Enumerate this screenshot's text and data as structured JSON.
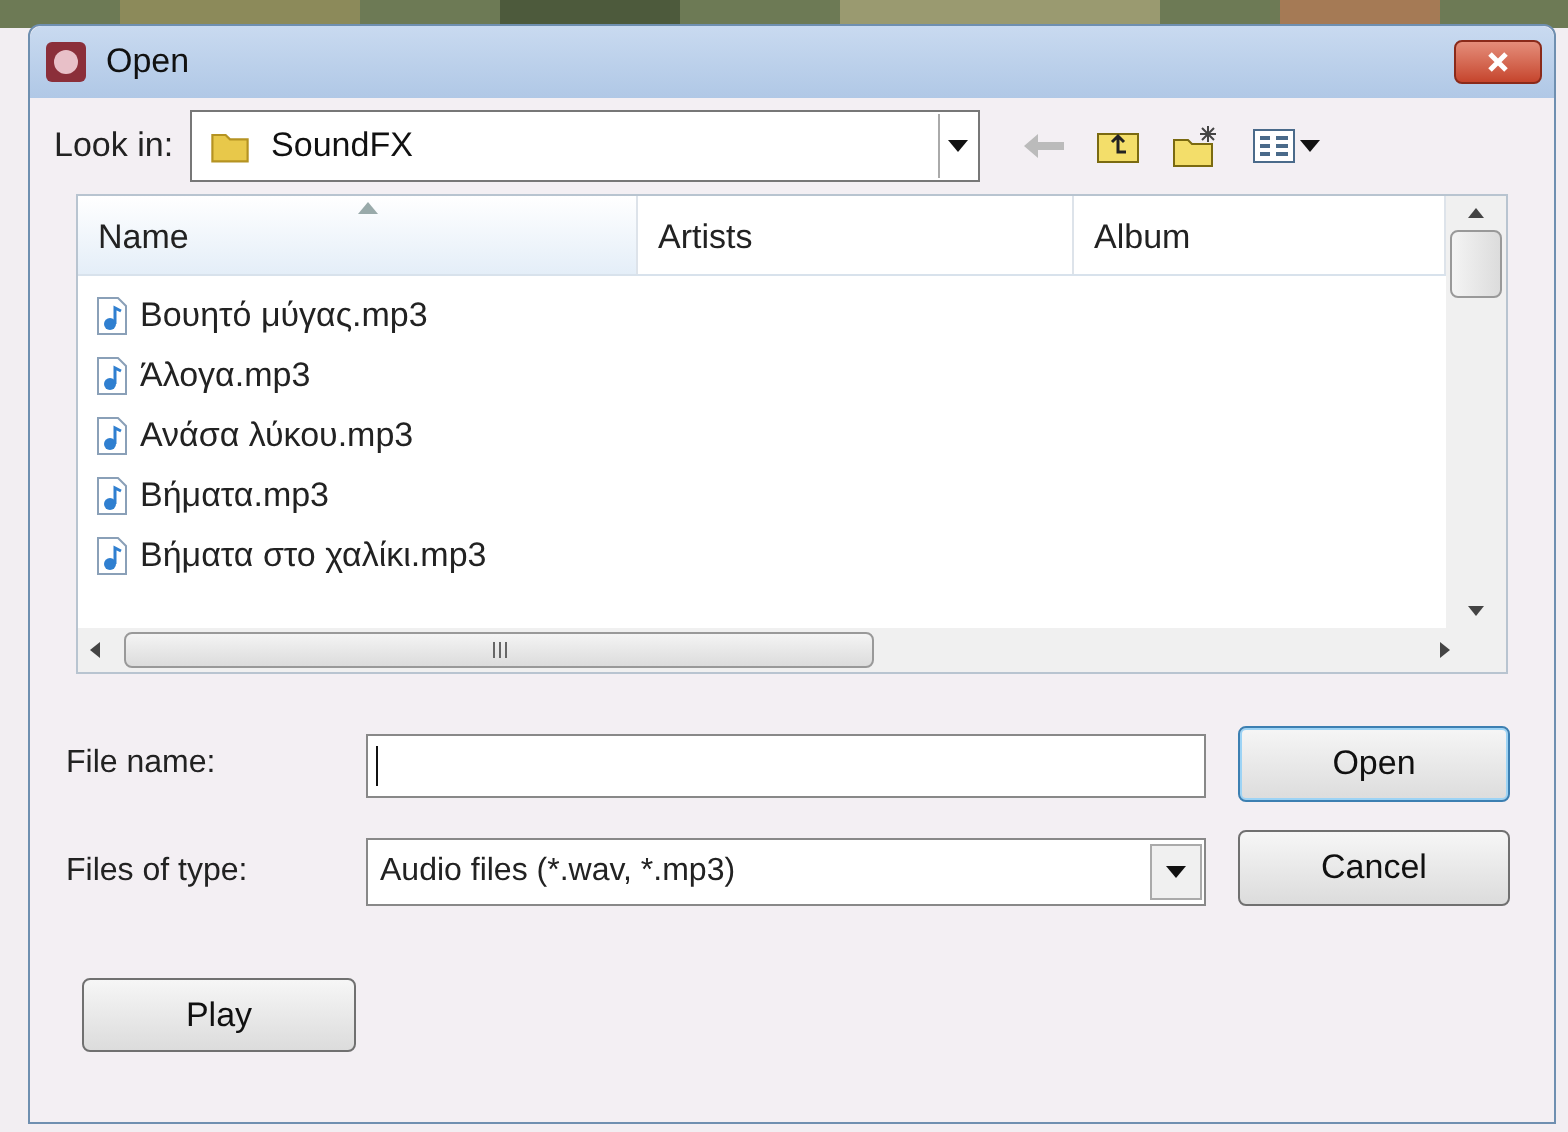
{
  "window": {
    "title": "Open"
  },
  "look_in": {
    "label": "Look in:",
    "value": "SoundFX"
  },
  "table": {
    "columns": [
      {
        "label": "Name",
        "sorted": true
      },
      {
        "label": "Artists",
        "sorted": false
      },
      {
        "label": "Album",
        "sorted": false
      }
    ],
    "rows": [
      {
        "name": "Βουητό μύγας.mp3"
      },
      {
        "name": "Άλογα.mp3"
      },
      {
        "name": "Ανάσα λύκου.mp3"
      },
      {
        "name": "Βήματα.mp3"
      },
      {
        "name": "Βήματα στο χαλίκι.mp3"
      }
    ]
  },
  "file_name": {
    "label": "File name:"
  },
  "file_type": {
    "label": "Files of type:",
    "value": "Audio files (*.wav, *.mp3)"
  },
  "buttons": [
    {
      "label": "Open",
      "kind": "default"
    },
    {
      "label": "Cancel",
      "kind": "normal"
    }
  ],
  "play_button": {
    "label": "Play"
  }
}
